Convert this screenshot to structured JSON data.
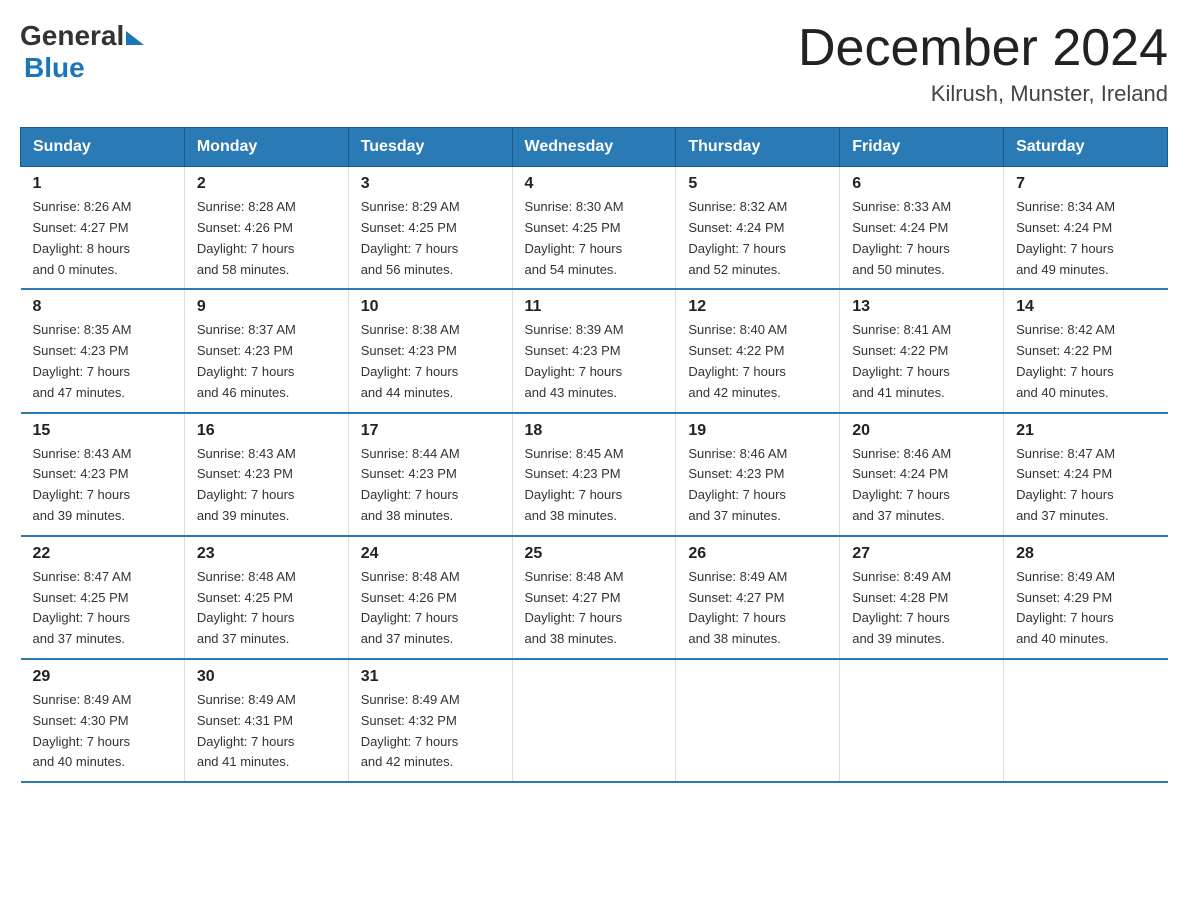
{
  "header": {
    "logo_general": "General",
    "logo_blue": "Blue",
    "month_title": "December 2024",
    "location": "Kilrush, Munster, Ireland"
  },
  "days_of_week": [
    "Sunday",
    "Monday",
    "Tuesday",
    "Wednesday",
    "Thursday",
    "Friday",
    "Saturday"
  ],
  "weeks": [
    [
      {
        "day": "1",
        "info": "Sunrise: 8:26 AM\nSunset: 4:27 PM\nDaylight: 8 hours\nand 0 minutes."
      },
      {
        "day": "2",
        "info": "Sunrise: 8:28 AM\nSunset: 4:26 PM\nDaylight: 7 hours\nand 58 minutes."
      },
      {
        "day": "3",
        "info": "Sunrise: 8:29 AM\nSunset: 4:25 PM\nDaylight: 7 hours\nand 56 minutes."
      },
      {
        "day": "4",
        "info": "Sunrise: 8:30 AM\nSunset: 4:25 PM\nDaylight: 7 hours\nand 54 minutes."
      },
      {
        "day": "5",
        "info": "Sunrise: 8:32 AM\nSunset: 4:24 PM\nDaylight: 7 hours\nand 52 minutes."
      },
      {
        "day": "6",
        "info": "Sunrise: 8:33 AM\nSunset: 4:24 PM\nDaylight: 7 hours\nand 50 minutes."
      },
      {
        "day": "7",
        "info": "Sunrise: 8:34 AM\nSunset: 4:24 PM\nDaylight: 7 hours\nand 49 minutes."
      }
    ],
    [
      {
        "day": "8",
        "info": "Sunrise: 8:35 AM\nSunset: 4:23 PM\nDaylight: 7 hours\nand 47 minutes."
      },
      {
        "day": "9",
        "info": "Sunrise: 8:37 AM\nSunset: 4:23 PM\nDaylight: 7 hours\nand 46 minutes."
      },
      {
        "day": "10",
        "info": "Sunrise: 8:38 AM\nSunset: 4:23 PM\nDaylight: 7 hours\nand 44 minutes."
      },
      {
        "day": "11",
        "info": "Sunrise: 8:39 AM\nSunset: 4:23 PM\nDaylight: 7 hours\nand 43 minutes."
      },
      {
        "day": "12",
        "info": "Sunrise: 8:40 AM\nSunset: 4:22 PM\nDaylight: 7 hours\nand 42 minutes."
      },
      {
        "day": "13",
        "info": "Sunrise: 8:41 AM\nSunset: 4:22 PM\nDaylight: 7 hours\nand 41 minutes."
      },
      {
        "day": "14",
        "info": "Sunrise: 8:42 AM\nSunset: 4:22 PM\nDaylight: 7 hours\nand 40 minutes."
      }
    ],
    [
      {
        "day": "15",
        "info": "Sunrise: 8:43 AM\nSunset: 4:23 PM\nDaylight: 7 hours\nand 39 minutes."
      },
      {
        "day": "16",
        "info": "Sunrise: 8:43 AM\nSunset: 4:23 PM\nDaylight: 7 hours\nand 39 minutes."
      },
      {
        "day": "17",
        "info": "Sunrise: 8:44 AM\nSunset: 4:23 PM\nDaylight: 7 hours\nand 38 minutes."
      },
      {
        "day": "18",
        "info": "Sunrise: 8:45 AM\nSunset: 4:23 PM\nDaylight: 7 hours\nand 38 minutes."
      },
      {
        "day": "19",
        "info": "Sunrise: 8:46 AM\nSunset: 4:23 PM\nDaylight: 7 hours\nand 37 minutes."
      },
      {
        "day": "20",
        "info": "Sunrise: 8:46 AM\nSunset: 4:24 PM\nDaylight: 7 hours\nand 37 minutes."
      },
      {
        "day": "21",
        "info": "Sunrise: 8:47 AM\nSunset: 4:24 PM\nDaylight: 7 hours\nand 37 minutes."
      }
    ],
    [
      {
        "day": "22",
        "info": "Sunrise: 8:47 AM\nSunset: 4:25 PM\nDaylight: 7 hours\nand 37 minutes."
      },
      {
        "day": "23",
        "info": "Sunrise: 8:48 AM\nSunset: 4:25 PM\nDaylight: 7 hours\nand 37 minutes."
      },
      {
        "day": "24",
        "info": "Sunrise: 8:48 AM\nSunset: 4:26 PM\nDaylight: 7 hours\nand 37 minutes."
      },
      {
        "day": "25",
        "info": "Sunrise: 8:48 AM\nSunset: 4:27 PM\nDaylight: 7 hours\nand 38 minutes."
      },
      {
        "day": "26",
        "info": "Sunrise: 8:49 AM\nSunset: 4:27 PM\nDaylight: 7 hours\nand 38 minutes."
      },
      {
        "day": "27",
        "info": "Sunrise: 8:49 AM\nSunset: 4:28 PM\nDaylight: 7 hours\nand 39 minutes."
      },
      {
        "day": "28",
        "info": "Sunrise: 8:49 AM\nSunset: 4:29 PM\nDaylight: 7 hours\nand 40 minutes."
      }
    ],
    [
      {
        "day": "29",
        "info": "Sunrise: 8:49 AM\nSunset: 4:30 PM\nDaylight: 7 hours\nand 40 minutes."
      },
      {
        "day": "30",
        "info": "Sunrise: 8:49 AM\nSunset: 4:31 PM\nDaylight: 7 hours\nand 41 minutes."
      },
      {
        "day": "31",
        "info": "Sunrise: 8:49 AM\nSunset: 4:32 PM\nDaylight: 7 hours\nand 42 minutes."
      },
      {
        "day": "",
        "info": ""
      },
      {
        "day": "",
        "info": ""
      },
      {
        "day": "",
        "info": ""
      },
      {
        "day": "",
        "info": ""
      }
    ]
  ]
}
